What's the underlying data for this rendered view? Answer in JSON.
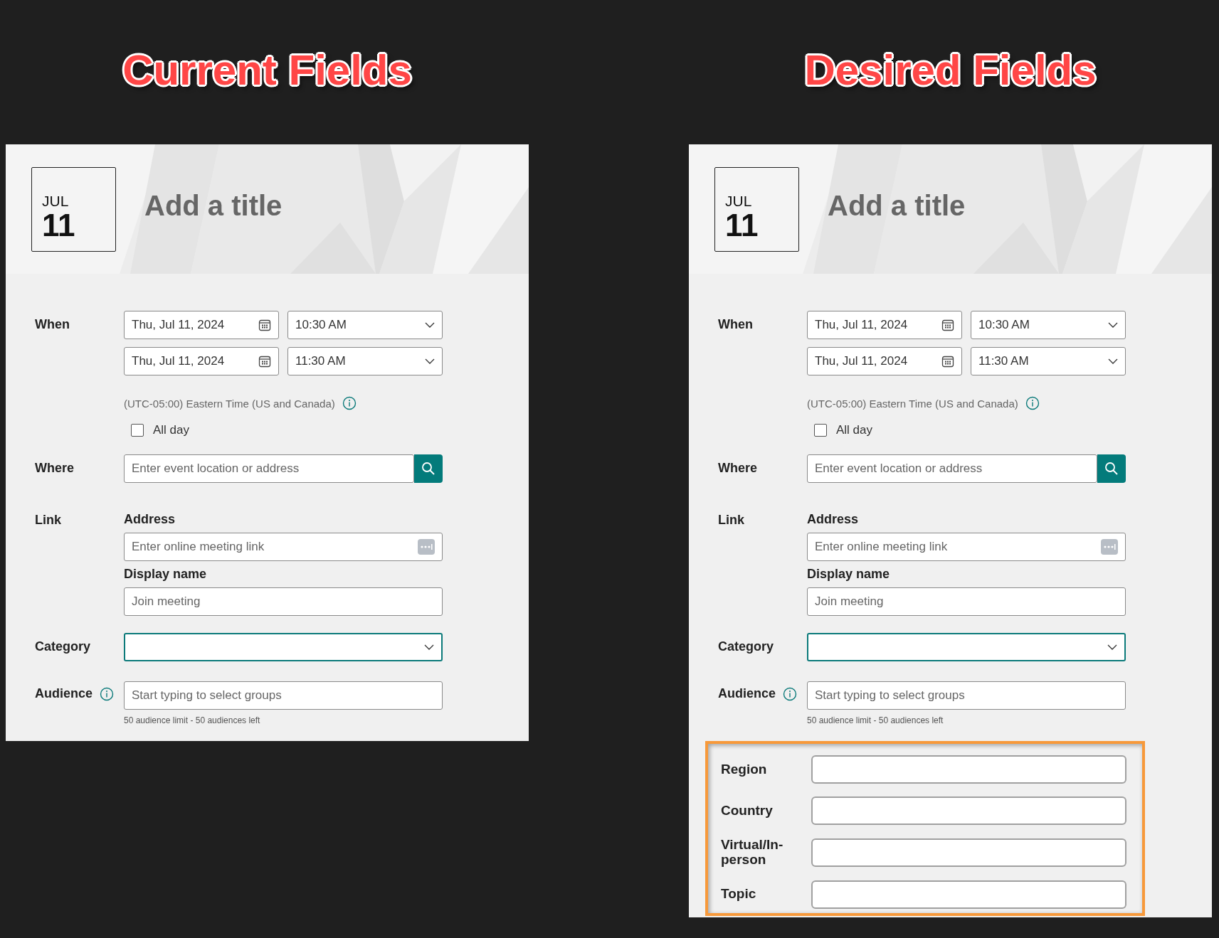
{
  "panels": [
    {
      "heading": "Current Fields",
      "date": {
        "month": "JUL",
        "day": "11"
      },
      "title_placeholder": "Add a title",
      "when": {
        "label": "When",
        "rows": [
          {
            "date": "Thu, Jul 11, 2024",
            "time": "10:30 AM"
          },
          {
            "date": "Thu, Jul 11, 2024",
            "time": "11:30 AM"
          }
        ],
        "timezone": "(UTC-05:00) Eastern Time (US and Canada)"
      },
      "all_day": {
        "label": "All day",
        "checked": false
      },
      "where": {
        "label": "Where",
        "placeholder": "Enter event location or address"
      },
      "link": {
        "label": "Link",
        "address_label": "Address",
        "address_placeholder": "Enter online meeting link",
        "display_label": "Display name",
        "display_placeholder": "Join meeting"
      },
      "category": {
        "label": "Category",
        "focused": true
      },
      "audience": {
        "label": "Audience",
        "placeholder": "Start typing to select groups",
        "limit": "50 audience limit - 50 audiences left"
      }
    },
    {
      "heading": "Desired Fields",
      "date": {
        "month": "JUL",
        "day": "11"
      },
      "title_placeholder": "Add a title",
      "when": {
        "label": "When",
        "rows": [
          {
            "date": "Thu, Jul 11, 2024",
            "time": "10:30 AM"
          },
          {
            "date": "Thu, Jul 11, 2024",
            "time": "11:30 AM"
          }
        ],
        "timezone": "(UTC-05:00) Eastern Time (US and Canada)"
      },
      "all_day": {
        "label": "All day",
        "checked": false
      },
      "where": {
        "label": "Where",
        "placeholder": "Enter event location or address"
      },
      "link": {
        "label": "Link",
        "address_label": "Address",
        "address_placeholder": "Enter online meeting link",
        "display_label": "Display name",
        "display_placeholder": "Join meeting"
      },
      "category": {
        "label": "Category",
        "focused": true
      },
      "audience": {
        "label": "Audience",
        "placeholder": "Start typing to select groups",
        "limit": "50 audience limit - 50 audiences left"
      },
      "extra_fields": [
        {
          "label": "Region"
        },
        {
          "label": "Country"
        },
        {
          "label": "Virtual/In-person"
        },
        {
          "label": "Topic"
        }
      ]
    }
  ]
}
